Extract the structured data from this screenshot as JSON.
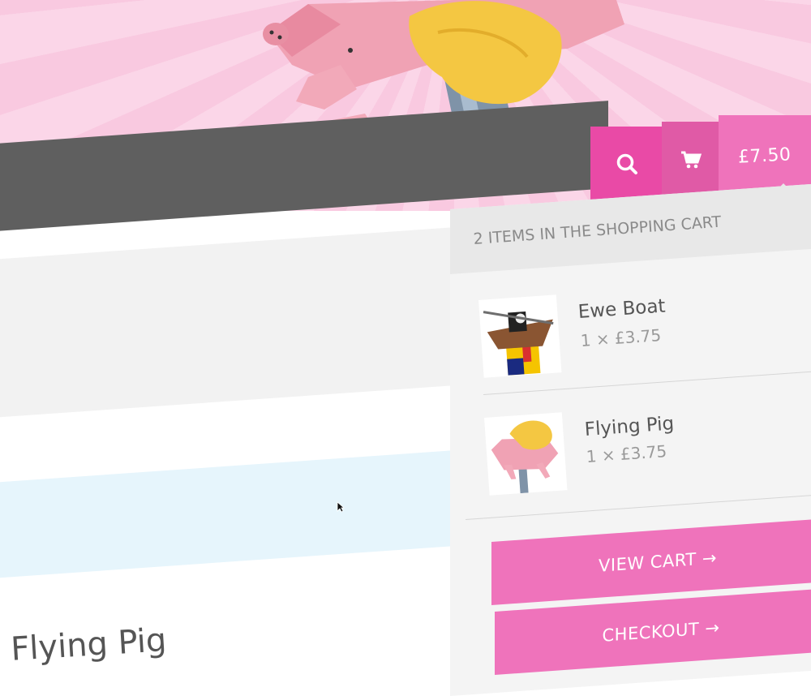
{
  "header": {
    "cart_total": "£7.50"
  },
  "icons": {
    "search": "search-icon",
    "cart": "shopping-cart-icon"
  },
  "cart_panel": {
    "title": "2 items in the shopping cart",
    "items": [
      {
        "name": "Ewe Boat",
        "qty": "1 × £3.75",
        "thumb": "ewe-boat-thumbnail"
      },
      {
        "name": "Flying Pig",
        "qty": "1 × £3.75",
        "thumb": "flying-pig-thumbnail"
      }
    ],
    "view_cart_label": "VIEW CART →",
    "checkout_label": "CHECKOUT →"
  },
  "product": {
    "title": "Flying Pig"
  },
  "colors": {
    "accent_pink": "#ef73bb",
    "accent_pink_dark": "#e94aa6",
    "nav_grey": "#5f5f5f",
    "hero_pink": "#f9c9e0"
  }
}
